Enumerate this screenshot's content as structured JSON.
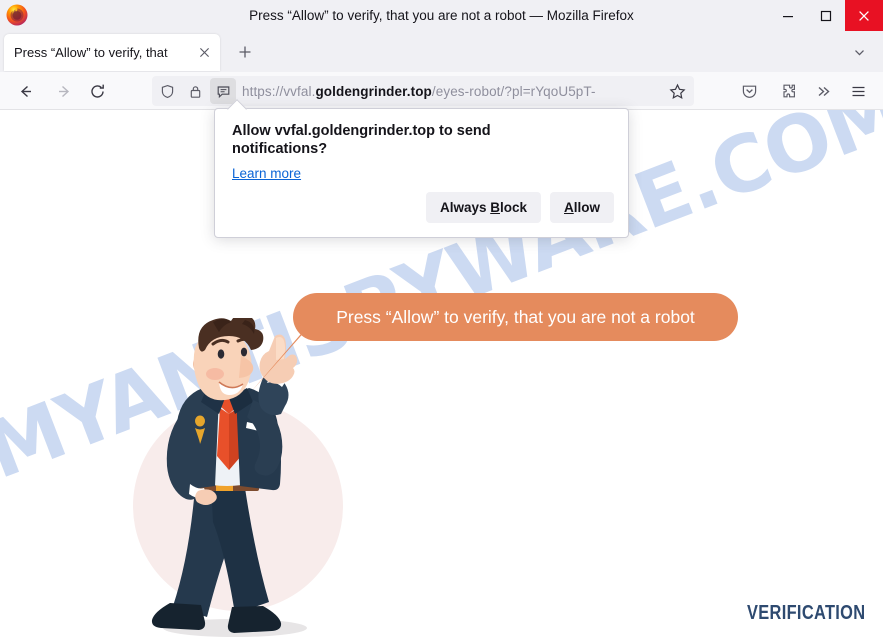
{
  "window": {
    "title": "Press “Allow” to verify, that you are not a robot — Mozilla Firefox",
    "logo_icon": "firefox-logo",
    "minimize_icon": "minimize-icon",
    "maximize_icon": "maximize-icon",
    "close_icon": "close-icon",
    "close_button_color": "#e81123"
  },
  "tabs": {
    "active_tab_title": "Press “Allow” to verify, that",
    "tab_close_icon": "close-icon",
    "new_tab_icon": "plus-icon",
    "tab_list_icon": "chevron-down-icon"
  },
  "toolbar": {
    "back_icon": "arrow-left-icon",
    "forward_icon": "arrow-right-icon",
    "reload_icon": "reload-icon",
    "shield_icon": "shield-icon",
    "lock_icon": "padlock-icon",
    "permission_icon": "speech-bubble-notification-icon",
    "bookmark_icon": "star-icon",
    "pocket_icon": "save-to-pocket-icon",
    "extensions_icon": "puzzle-piece-icon",
    "overflow_icon": "double-chevron-right-icon",
    "menu_icon": "hamburger-menu-icon",
    "url_prefix": "https://vvfal.",
    "url_domain": "goldengrinder.top",
    "url_suffix": "/eyes-robot/?pl=rYqoU5pT-"
  },
  "permission_popup": {
    "heading": "Allow vvfal.goldengrinder.top to send notifications?",
    "learn_more": "Learn more",
    "always_block_pre": "Always ",
    "always_block_key": "B",
    "always_block_post": "lock",
    "allow_key": "A",
    "allow_post": "llow"
  },
  "page": {
    "bubble_text": "Press “Allow” to verify, that you are not a robot",
    "bubble_color": "#e58b5d",
    "watermark_text": "MYANTISPYWARE.COM",
    "watermark_color": "#ccdaf2",
    "verification_logo": "VERIFICATION",
    "verification_color": "#2e4a70",
    "character_name": "cartoon-businessman-pointing-up",
    "suit_color": "#273a4d",
    "tie_color": "#e8502a"
  }
}
